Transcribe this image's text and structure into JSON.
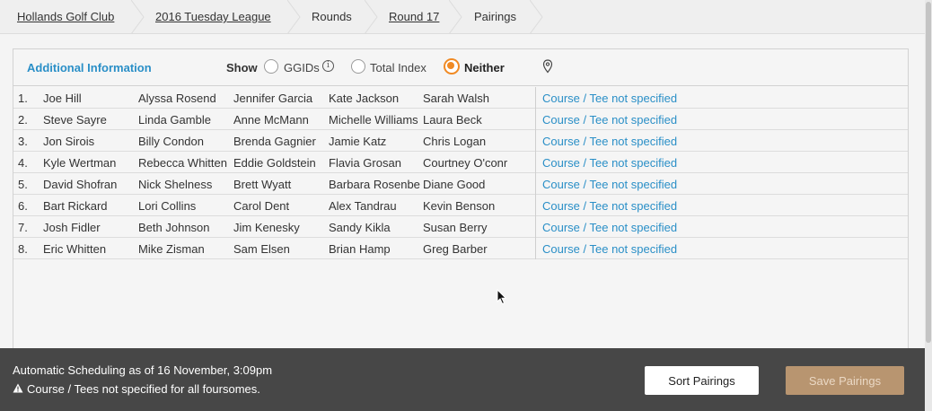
{
  "breadcrumb": {
    "items": [
      {
        "label": "Hollands Golf Club",
        "link": true
      },
      {
        "label": "2016 Tuesday League",
        "link": true
      },
      {
        "label": "Rounds",
        "link": false
      },
      {
        "label": "Round 17",
        "link": true
      },
      {
        "label": "Pairings",
        "link": false
      }
    ]
  },
  "info": {
    "title": "Additional Information",
    "show_label": "Show",
    "options": [
      {
        "label": "GGIDs",
        "checked": false
      },
      {
        "label": "Total Index",
        "checked": false
      },
      {
        "label": "Neither",
        "checked": true
      }
    ],
    "info_icon": "info-icon",
    "pin_icon": "map-pin-icon"
  },
  "pairings": [
    {
      "num": "1.",
      "players": [
        "Joe Hill",
        "Alyssa Rosend",
        "Jennifer Garcia",
        "Kate Jackson",
        "Sarah Walsh"
      ],
      "course": "Course / Tee not specified"
    },
    {
      "num": "2.",
      "players": [
        "Steve Sayre",
        "Linda Gamble",
        "Anne McMann",
        "Michelle Williams",
        "Laura Beck"
      ],
      "course": "Course / Tee not specified"
    },
    {
      "num": "3.",
      "players": [
        "Jon Sirois",
        "Billy Condon",
        "Brenda Gagnier",
        "Jamie Katz",
        "Chris Logan"
      ],
      "course": "Course / Tee not specified"
    },
    {
      "num": "4.",
      "players": [
        "Kyle Wertman",
        "Rebecca Whitten",
        "Eddie Goldstein",
        "Flavia Grosan",
        "Courtney O'conr"
      ],
      "course": "Course / Tee not specified"
    },
    {
      "num": "5.",
      "players": [
        "David Shofran",
        "Nick Shelness",
        "Brett Wyatt",
        "Barbara Rosenberg",
        "Diane Good"
      ],
      "course": "Course / Tee not specified"
    },
    {
      "num": "6.",
      "players": [
        "Bart Rickard",
        "Lori Collins",
        "Carol Dent",
        "Alex Tandrau",
        "Kevin Benson"
      ],
      "course": "Course / Tee not specified"
    },
    {
      "num": "7.",
      "players": [
        "Josh Fidler",
        "Beth Johnson",
        "Jim Kenesky",
        "Sandy Kikla",
        "Susan Berry"
      ],
      "course": "Course / Tee not specified"
    },
    {
      "num": "8.",
      "players": [
        "Eric Whitten",
        "Mike Zisman",
        "Sam Elsen",
        "Brian Hamp",
        "Greg Barber"
      ],
      "course": "Course / Tee not specified"
    }
  ],
  "footer": {
    "schedule": "Automatic Scheduling as of 16 November, 3:09pm",
    "warning": "Course / Tees not specified for all foursomes.",
    "sort_label": "Sort Pairings",
    "save_label": "Save Pairings"
  },
  "colors": {
    "accent": "#2a8fc7",
    "radio_checked": "#f08a24",
    "footer_bg": "#474747",
    "save_button": "#b89570"
  }
}
